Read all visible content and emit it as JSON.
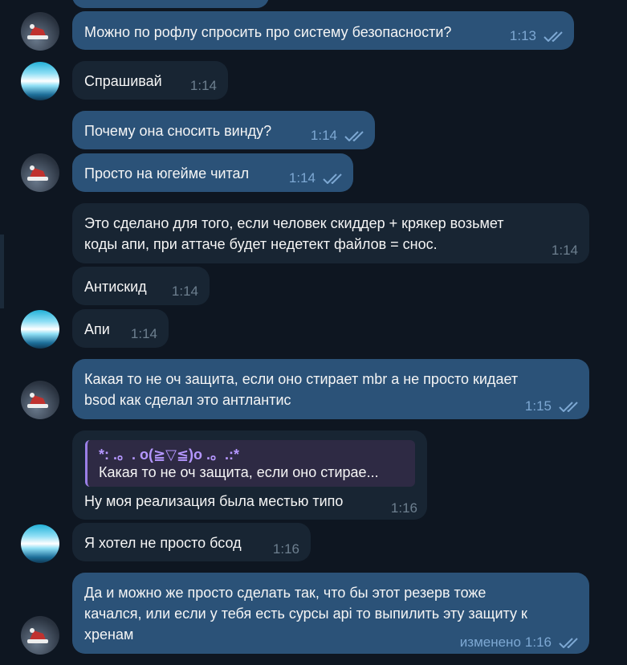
{
  "messages": [
    {
      "text": "Можно по рофлу спросить про систему безопасности?",
      "time": "1:13"
    },
    {
      "text": "Спрашивай",
      "time": "1:14"
    },
    {
      "text": "Почему она сносить винду?",
      "time": "1:14"
    },
    {
      "text": "Просто на югейме читал",
      "time": "1:14"
    },
    {
      "lines": [
        "Это сделано для того, если человек скиддер + крякер возьмет",
        "коды апи, при аттаче будет недетект файлов = снос."
      ],
      "time": "1:14"
    },
    {
      "text": "Антискид",
      "time": "1:14"
    },
    {
      "text": "Апи",
      "time": "1:14"
    },
    {
      "lines": [
        "Какая то не оч защита, если оно стирает mbr а не просто кидает",
        "bsod как сделал это антлантис"
      ],
      "time": "1:15"
    },
    {
      "reply": {
        "author": "*: .。. o(≧▽≦)o .。.:*",
        "text": "Какая то не оч защита, если оно стирае..."
      },
      "text": "Ну моя реализация была местью типо",
      "time": "1:16"
    },
    {
      "text": "Я хотел не просто бсод",
      "time": "1:16"
    },
    {
      "lines": [
        "Да и можно же просто сделать так, что бы этот резерв тоже",
        "качался, или если у тебя есть сурсы api то выпилить эту защиту к",
        "хренам"
      ],
      "edited_label": "изменено",
      "time": "1:16"
    }
  ],
  "colors": {
    "background": "#0e1621",
    "outgoing_bubble": "#2b5278",
    "incoming_bubble": "#182533",
    "reply_accent": "#9a7fe6",
    "read_ticks": "#7da8d3"
  },
  "icons": [
    "avatar-santa-hat",
    "avatar-blue-glow",
    "double-check-icon"
  ]
}
